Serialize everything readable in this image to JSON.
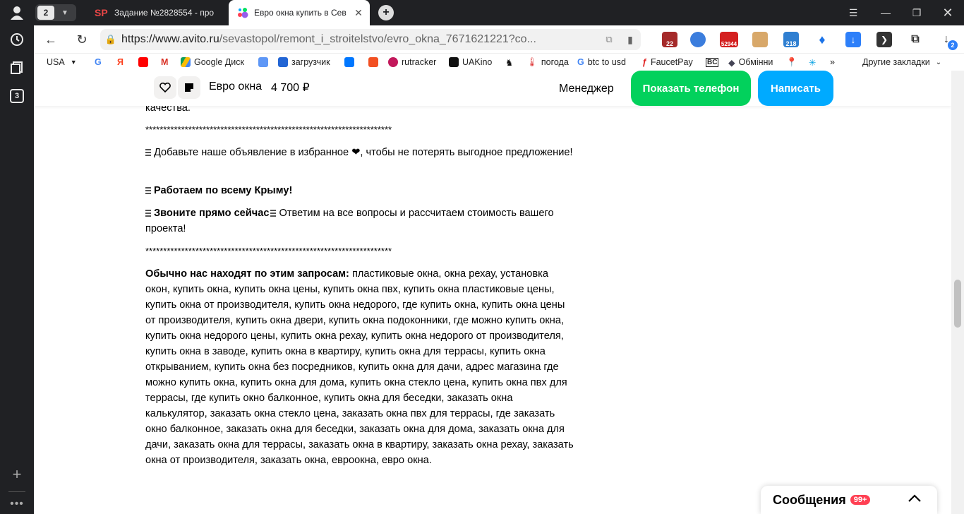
{
  "sidebar": {
    "tabs_count": "3"
  },
  "tabbar": {
    "tab_counter": "2",
    "tabs": [
      {
        "title": "Задание №2828554 - про",
        "favicon": "SP"
      },
      {
        "title": "Евро окна купить в Сев",
        "favicon": "avito"
      }
    ]
  },
  "toolbar": {
    "url_host": "https://www.avito.ru",
    "url_path": "/sevastopol/remont_i_stroitelstvo/evro_okna_7671621221?co...",
    "ext_badges": [
      "22",
      "52944",
      "218"
    ],
    "downloads_badge": "2"
  },
  "bookmarks": {
    "items": [
      "USA",
      "Google Диск",
      "загрузчик",
      "rutracker",
      "UAKino",
      "погода",
      "btc to usd",
      "FaucetPay",
      "Обмінни"
    ],
    "other": "Другие закладки",
    "more": "»"
  },
  "colors": {
    "green": "#02d15c",
    "blue": "#00aaff",
    "badge": "#ff4053"
  },
  "sticky_header": {
    "title": "Евро окна",
    "price": "4 700 ₽",
    "manager": "Менеджер",
    "phone_button": "Показать телефон",
    "write_button": "Написать"
  },
  "description": {
    "line_top": "качества.",
    "stars": "*********************************************************************",
    "favorite_text": "Добавьте наше объявление в избранное ❤, чтобы не потерять выгодное предложение!",
    "crimea": "Работаем по всему Крыму!",
    "call_bold": "Звоните прямо сейчас",
    "call_rest": "Ответим на все вопросы и рассчитаем стоимость вашего проекта!",
    "queries_bold": "Обычно нас находят по этим запросам:",
    "queries_text": "пластиковые окна, окна рехау, установка окон, купить окна, купить окна цены, купить окна пвх, купить окна пластиковые цены, купить окна от производителя, купить окна недорого, где купить окна, купить окна цены от производителя, купить окна двери, купить окна подоконники, где можно купить окна, купить окна недорого цены, купить окна рехау, купить окна недорого от производителя, купить окна в заводе, купить окна в квартиру, купить окна для террасы, купить окна открыванием, купить окна без посредников, купить окна для дачи, адрес магазина где можно купить окна, купить окна для дома, купить окна стекло цена, купить окна пвх для террасы, где купить окно балконное, купить окна для беседки, заказать окна калькулятор, заказать окна стекло цена, заказать окна пвх для террасы, где заказать окно балконное, заказать окна для беседки, заказать окна для дома, заказать окна для дачи, заказать окна для террасы, заказать окна в квартиру, заказать окна рехау, заказать окна от производителя, заказать окна, евроокна, евро окна."
  },
  "messages": {
    "label": "Сообщения",
    "badge": "99+"
  }
}
